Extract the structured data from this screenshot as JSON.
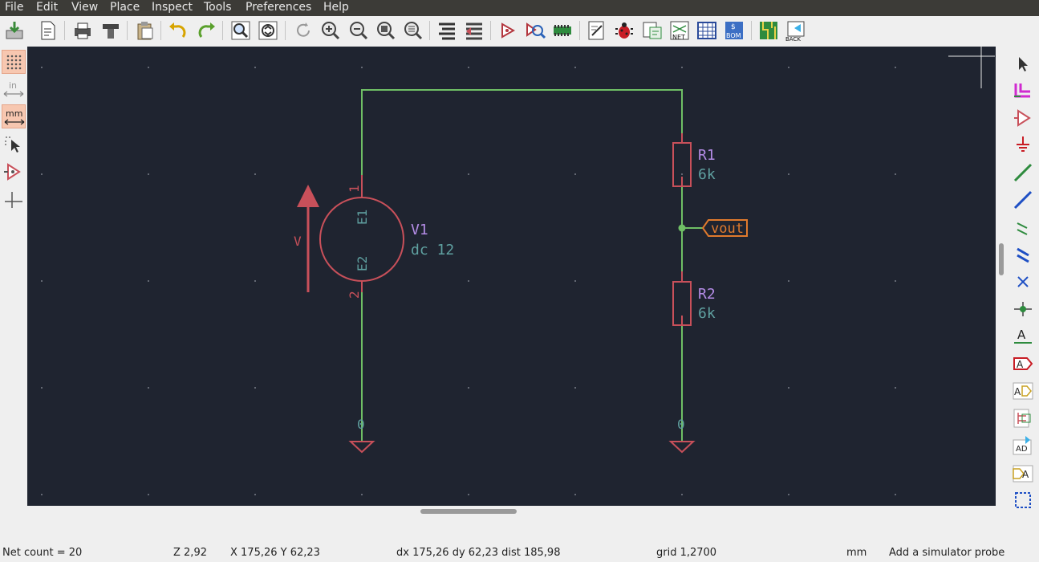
{
  "menu": [
    "File",
    "Edit",
    "View",
    "Place",
    "Inspect",
    "Tools",
    "Preferences",
    "Help"
  ],
  "schematic": {
    "r1": {
      "ref": "R1",
      "value": "6k"
    },
    "r2": {
      "ref": "R2",
      "value": "6k"
    },
    "v1": {
      "ref": "V1",
      "value": "dc 12",
      "pin1_num": "1",
      "pin1_name": "E1",
      "pin2_num": "2",
      "pin2_name": "E2",
      "symbol_label": "V"
    },
    "net_label": "vout",
    "ground_left": "0",
    "ground_right": "0"
  },
  "status": {
    "net_count": "Net count = 20",
    "zoom": "Z 2,92",
    "xy": "X 175,26  Y 62,23",
    "delta": "dx 175,26  dy 62,23  dist 185,98",
    "grid": "grid 1,2700",
    "units": "mm",
    "message": "Add a simulator probe"
  },
  "units_labels": {
    "inch": "in",
    "mm": "mm"
  },
  "colors": {
    "canvas_bg": "#1f2430",
    "wire": "#6fbf65",
    "symbol": "#c8505a",
    "reference": "#b48ce6",
    "value": "#5fa0a0",
    "net_label": "#e07a2d"
  }
}
